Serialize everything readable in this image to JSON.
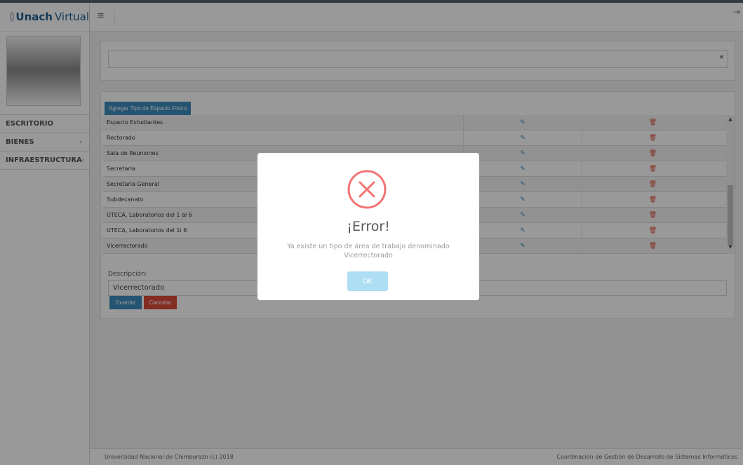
{
  "brand": {
    "bold": "Unach",
    "light": "Virtual"
  },
  "sidebar": {
    "items": [
      {
        "label": "ESCRITORIO",
        "chevron": ""
      },
      {
        "label": "BIENES",
        "chevron": "‹"
      },
      {
        "label": "INFRAESTRUCTURA",
        "chevron": "‹"
      }
    ]
  },
  "topbar": {
    "menu_icon": "≡",
    "logout_icon": "⇥"
  },
  "toolbar": {
    "add_label": "Agregar Tipo de Espacio Físico"
  },
  "table": {
    "rows": [
      "Espacio Estudiantes",
      "Rectorado",
      "Sala de Reuniones",
      "Secretaria",
      "Secretaria General",
      "Subdecanato",
      "UTECA, Laboratorios del 1 al 6",
      "UTECA, Laboratorios del 1i 6",
      "Vicerrectorado"
    ],
    "edit_icon": "✎",
    "delete_icon": "🗑"
  },
  "form": {
    "desc_label": "Descripción:",
    "desc_value": "Vicerrectorado",
    "save_label": "Guardar",
    "cancel_label": "Cancelar"
  },
  "footer": {
    "left": "Universidad Nacional de Chimborazo (c) 2018",
    "right": "Coordinación de Gestión de Desarrollo de Sistemas Informáticos"
  },
  "modal": {
    "title": "¡Error!",
    "text": "Ya existe un tipo de área de trabajo denominado Vicerrectorado",
    "ok_label": "OK"
  },
  "colors": {
    "accent": "#3c8dbc",
    "danger": "#dd4b39",
    "error_icon": "#f27474"
  }
}
